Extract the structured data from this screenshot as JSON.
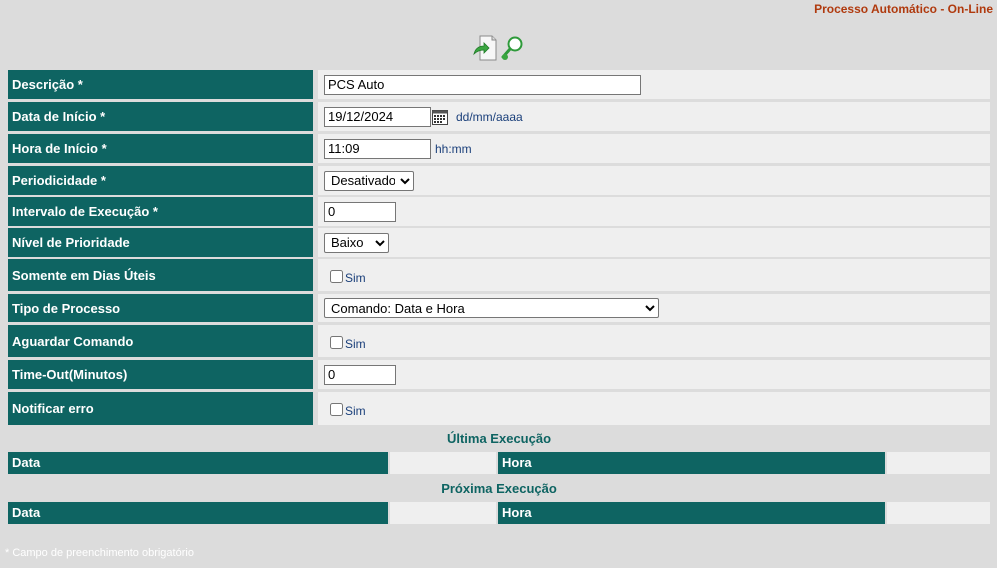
{
  "header": {
    "title": "Processo Automático - On-Line"
  },
  "toolbar": {
    "icons": [
      "export-page-icon",
      "search-magnifier-icon"
    ]
  },
  "form": {
    "descricao": {
      "label": "Descrição *",
      "value": "PCS Auto"
    },
    "data_inicio": {
      "label": "Data de Início *",
      "value": "19/12/2024",
      "hint": "dd/mm/aaaa"
    },
    "hora_inicio": {
      "label": "Hora de Início *",
      "value": "11:09",
      "hint": "hh:mm"
    },
    "periodicidade": {
      "label": "Periodicidade *",
      "selected": "Desativado"
    },
    "intervalo": {
      "label": "Intervalo de Execução *",
      "value": "0"
    },
    "prioridade": {
      "label": "Nível de Prioridade",
      "selected": "Baixo"
    },
    "dias_uteis": {
      "label": "Somente em Dias Úteis",
      "checkbox_label": "Sim",
      "checked": false
    },
    "tipo_processo": {
      "label": "Tipo de Processo",
      "selected": "Comando: Data e Hora"
    },
    "aguardar": {
      "label": "Aguardar Comando",
      "checkbox_label": "Sim",
      "checked": false
    },
    "timeout": {
      "label": "Time-Out(Minutos)",
      "value": "0"
    },
    "notificar": {
      "label": "Notificar erro",
      "checkbox_label": "Sim",
      "checked": false
    }
  },
  "ultima_execucao": {
    "title": "Última Execução",
    "data_label": "Data",
    "data_value": "",
    "hora_label": "Hora",
    "hora_value": ""
  },
  "proxima_execucao": {
    "title": "Próxima Execução",
    "data_label": "Data",
    "data_value": "",
    "hora_label": "Hora",
    "hora_value": ""
  },
  "footnote": "* Campo de preenchimento obrigatório",
  "colors": {
    "accent": "#0e6462",
    "title": "#b03a0e",
    "hint": "#1a3f7a"
  }
}
